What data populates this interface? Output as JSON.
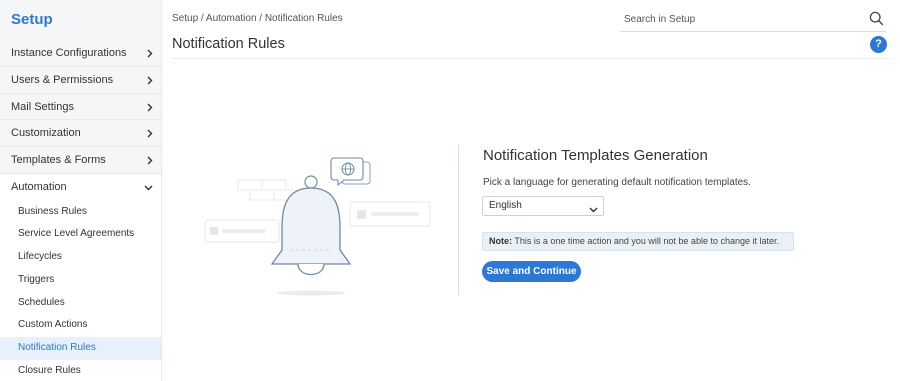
{
  "sidebar": {
    "title": "Setup",
    "items": [
      {
        "label": "Instance Configurations"
      },
      {
        "label": "Users & Permissions"
      },
      {
        "label": "Mail Settings"
      },
      {
        "label": "Customization"
      },
      {
        "label": "Templates & Forms"
      },
      {
        "label": "Automation"
      }
    ],
    "automation_items": [
      {
        "label": "Business Rules"
      },
      {
        "label": "Service Level Agreements"
      },
      {
        "label": "Lifecycles"
      },
      {
        "label": "Triggers"
      },
      {
        "label": "Schedules"
      },
      {
        "label": "Custom Actions"
      },
      {
        "label": "Notification Rules"
      },
      {
        "label": "Closure Rules"
      }
    ],
    "active_item": "Notification Rules"
  },
  "header": {
    "breadcrumb": "Setup / Automation / Notification Rules",
    "title": "Notification Rules",
    "search_placeholder": "Search in Setup",
    "help_label": "?"
  },
  "main": {
    "title": "Notification Templates Generation",
    "description": "Pick a language for generating default notification templates.",
    "language_selected": "English",
    "note_label": "Note:",
    "note_text": " This is a one time action and you will not be able to change it later.",
    "save_button": "Save and Continue"
  },
  "colors": {
    "accent": "#2c78d4",
    "sidebar_bg": "#f5f6f7",
    "active_bg": "#e7f1fc",
    "note_bg": "#eaf1f6"
  }
}
